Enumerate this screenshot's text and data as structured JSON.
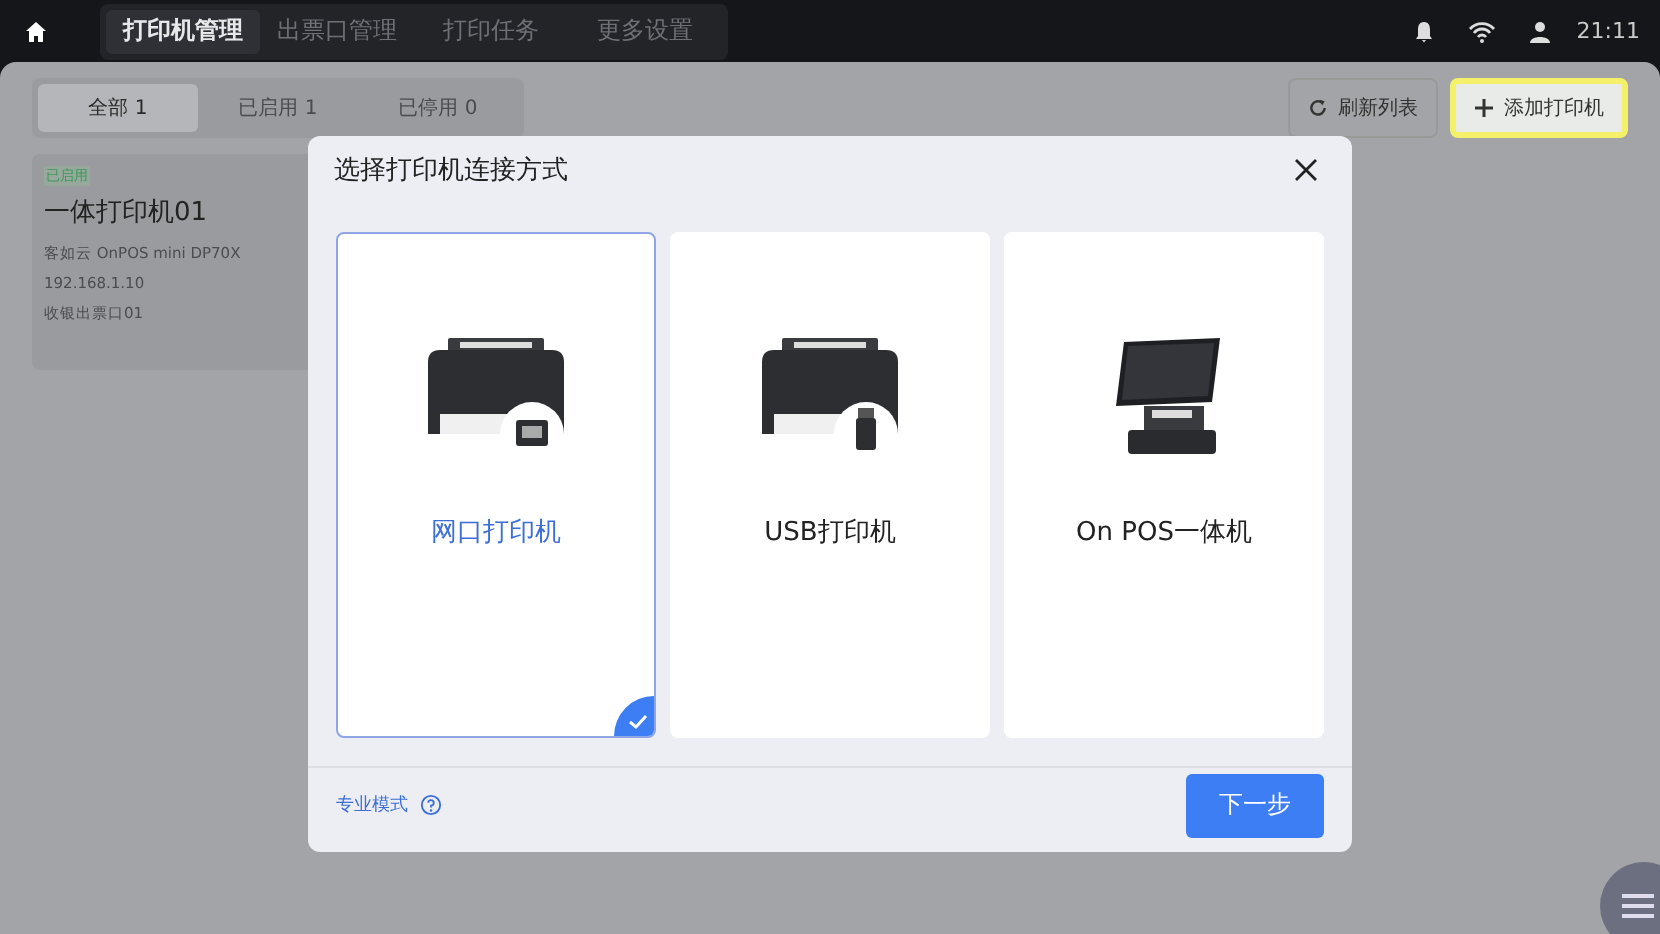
{
  "top_bar": {
    "nav_tabs": [
      {
        "label": "打印机管理",
        "selected": true
      },
      {
        "label": "出票口管理",
        "selected": false
      },
      {
        "label": "打印任务",
        "selected": false
      },
      {
        "label": "更多设置",
        "selected": false
      }
    ],
    "time": "21:11"
  },
  "filter_tabs": [
    {
      "label": "全部 1",
      "selected": true
    },
    {
      "label": "已启用 1",
      "selected": false
    },
    {
      "label": "已停用 0",
      "selected": false
    }
  ],
  "toolbar": {
    "refresh": "刷新列表",
    "add": "添加打印机"
  },
  "printers": [
    {
      "status": "已启用",
      "name": "一体打印机01",
      "model": "客如云 OnPOS mini DP70X",
      "ip": "192.168.1.10",
      "outlet": "收银出票口01"
    }
  ],
  "dialog": {
    "title": "选择打印机连接方式",
    "options": [
      {
        "kind": "network",
        "label": "网口打印机",
        "selected": true
      },
      {
        "kind": "usb",
        "label": "USB打印机",
        "selected": false
      },
      {
        "kind": "pos",
        "label": "On POS一体机",
        "selected": false
      }
    ],
    "pro_mode": "专业模式",
    "next": "下一步"
  }
}
